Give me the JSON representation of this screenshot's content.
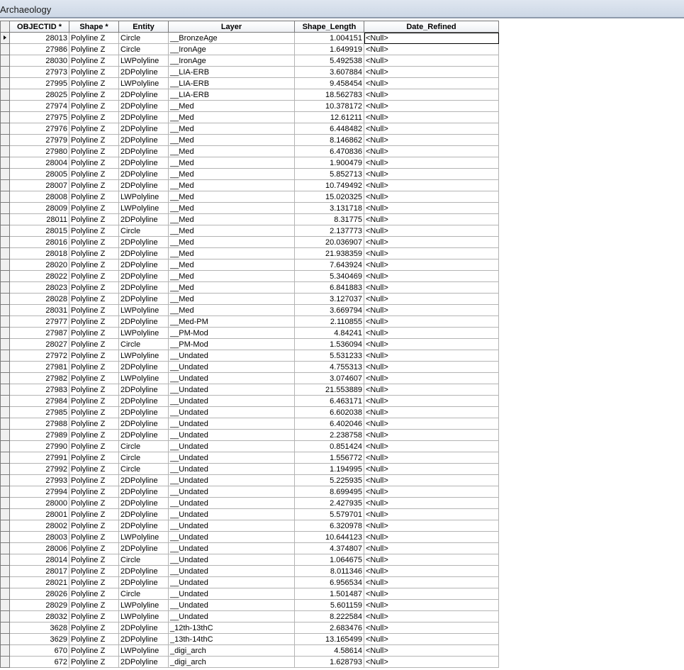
{
  "window": {
    "title": "Archaeology"
  },
  "table": {
    "columns": [
      "OBJECTID *",
      "Shape *",
      "Entity",
      "Layer",
      "Shape_Length",
      "Date_Refined"
    ],
    "rows": [
      [
        "28013",
        "Polyline Z",
        "Circle",
        "__BronzeAge",
        "1.004151",
        "<Null>"
      ],
      [
        "27986",
        "Polyline Z",
        "Circle",
        "__IronAge",
        "1.649919",
        "<Null>"
      ],
      [
        "28030",
        "Polyline Z",
        "LWPolyline",
        "__IronAge",
        "5.492538",
        "<Null>"
      ],
      [
        "27973",
        "Polyline Z",
        "2DPolyline",
        "__LIA-ERB",
        "3.607884",
        "<Null>"
      ],
      [
        "27995",
        "Polyline Z",
        "LWPolyline",
        "__LIA-ERB",
        "9.458454",
        "<Null>"
      ],
      [
        "28025",
        "Polyline Z",
        "2DPolyline",
        "__LIA-ERB",
        "18.562783",
        "<Null>"
      ],
      [
        "27974",
        "Polyline Z",
        "2DPolyline",
        "__Med",
        "10.378172",
        "<Null>"
      ],
      [
        "27975",
        "Polyline Z",
        "2DPolyline",
        "__Med",
        "12.61211",
        "<Null>"
      ],
      [
        "27976",
        "Polyline Z",
        "2DPolyline",
        "__Med",
        "6.448482",
        "<Null>"
      ],
      [
        "27979",
        "Polyline Z",
        "2DPolyline",
        "__Med",
        "8.146862",
        "<Null>"
      ],
      [
        "27980",
        "Polyline Z",
        "2DPolyline",
        "__Med",
        "6.470836",
        "<Null>"
      ],
      [
        "28004",
        "Polyline Z",
        "2DPolyline",
        "__Med",
        "1.900479",
        "<Null>"
      ],
      [
        "28005",
        "Polyline Z",
        "2DPolyline",
        "__Med",
        "5.852713",
        "<Null>"
      ],
      [
        "28007",
        "Polyline Z",
        "2DPolyline",
        "__Med",
        "10.749492",
        "<Null>"
      ],
      [
        "28008",
        "Polyline Z",
        "LWPolyline",
        "__Med",
        "15.020325",
        "<Null>"
      ],
      [
        "28009",
        "Polyline Z",
        "LWPolyline",
        "__Med",
        "3.131718",
        "<Null>"
      ],
      [
        "28011",
        "Polyline Z",
        "2DPolyline",
        "__Med",
        "8.31775",
        "<Null>"
      ],
      [
        "28015",
        "Polyline Z",
        "Circle",
        "__Med",
        "2.137773",
        "<Null>"
      ],
      [
        "28016",
        "Polyline Z",
        "2DPolyline",
        "__Med",
        "20.036907",
        "<Null>"
      ],
      [
        "28018",
        "Polyline Z",
        "2DPolyline",
        "__Med",
        "21.938359",
        "<Null>"
      ],
      [
        "28020",
        "Polyline Z",
        "2DPolyline",
        "__Med",
        "7.643924",
        "<Null>"
      ],
      [
        "28022",
        "Polyline Z",
        "2DPolyline",
        "__Med",
        "5.340469",
        "<Null>"
      ],
      [
        "28023",
        "Polyline Z",
        "2DPolyline",
        "__Med",
        "6.841883",
        "<Null>"
      ],
      [
        "28028",
        "Polyline Z",
        "2DPolyline",
        "__Med",
        "3.127037",
        "<Null>"
      ],
      [
        "28031",
        "Polyline Z",
        "LWPolyline",
        "__Med",
        "3.669794",
        "<Null>"
      ],
      [
        "27977",
        "Polyline Z",
        "2DPolyline",
        "__Med-PM",
        "2.110855",
        "<Null>"
      ],
      [
        "27987",
        "Polyline Z",
        "LWPolyline",
        "__PM-Mod",
        "4.84241",
        "<Null>"
      ],
      [
        "28027",
        "Polyline Z",
        "Circle",
        "__PM-Mod",
        "1.536094",
        "<Null>"
      ],
      [
        "27972",
        "Polyline Z",
        "LWPolyline",
        "__Undated",
        "5.531233",
        "<Null>"
      ],
      [
        "27981",
        "Polyline Z",
        "2DPolyline",
        "__Undated",
        "4.755313",
        "<Null>"
      ],
      [
        "27982",
        "Polyline Z",
        "LWPolyline",
        "__Undated",
        "3.074607",
        "<Null>"
      ],
      [
        "27983",
        "Polyline Z",
        "2DPolyline",
        "__Undated",
        "21.553889",
        "<Null>"
      ],
      [
        "27984",
        "Polyline Z",
        "2DPolyline",
        "__Undated",
        "6.463171",
        "<Null>"
      ],
      [
        "27985",
        "Polyline Z",
        "2DPolyline",
        "__Undated",
        "6.602038",
        "<Null>"
      ],
      [
        "27988",
        "Polyline Z",
        "2DPolyline",
        "__Undated",
        "6.402046",
        "<Null>"
      ],
      [
        "27989",
        "Polyline Z",
        "2DPolyline",
        "__Undated",
        "2.238758",
        "<Null>"
      ],
      [
        "27990",
        "Polyline Z",
        "Circle",
        "__Undated",
        "0.851424",
        "<Null>"
      ],
      [
        "27991",
        "Polyline Z",
        "Circle",
        "__Undated",
        "1.556772",
        "<Null>"
      ],
      [
        "27992",
        "Polyline Z",
        "Circle",
        "__Undated",
        "1.194995",
        "<Null>"
      ],
      [
        "27993",
        "Polyline Z",
        "2DPolyline",
        "__Undated",
        "5.225935",
        "<Null>"
      ],
      [
        "27994",
        "Polyline Z",
        "2DPolyline",
        "__Undated",
        "8.699495",
        "<Null>"
      ],
      [
        "28000",
        "Polyline Z",
        "2DPolyline",
        "__Undated",
        "2.427935",
        "<Null>"
      ],
      [
        "28001",
        "Polyline Z",
        "2DPolyline",
        "__Undated",
        "5.579701",
        "<Null>"
      ],
      [
        "28002",
        "Polyline Z",
        "2DPolyline",
        "__Undated",
        "6.320978",
        "<Null>"
      ],
      [
        "28003",
        "Polyline Z",
        "LWPolyline",
        "__Undated",
        "10.644123",
        "<Null>"
      ],
      [
        "28006",
        "Polyline Z",
        "2DPolyline",
        "__Undated",
        "4.374807",
        "<Null>"
      ],
      [
        "28014",
        "Polyline Z",
        "Circle",
        "__Undated",
        "1.064675",
        "<Null>"
      ],
      [
        "28017",
        "Polyline Z",
        "2DPolyline",
        "__Undated",
        "8.011346",
        "<Null>"
      ],
      [
        "28021",
        "Polyline Z",
        "2DPolyline",
        "__Undated",
        "6.956534",
        "<Null>"
      ],
      [
        "28026",
        "Polyline Z",
        "Circle",
        "__Undated",
        "1.501487",
        "<Null>"
      ],
      [
        "28029",
        "Polyline Z",
        "LWPolyline",
        "__Undated",
        "5.601159",
        "<Null>"
      ],
      [
        "28032",
        "Polyline Z",
        "LWPolyline",
        "__Undated",
        "8.222584",
        "<Null>"
      ],
      [
        "3628",
        "Polyline Z",
        "2DPolyline",
        "_12th-13thC",
        "2.683476",
        "<Null>"
      ],
      [
        "3629",
        "Polyline Z",
        "2DPolyline",
        "_13th-14thC",
        "13.165499",
        "<Null>"
      ],
      [
        "670",
        "Polyline Z",
        "LWPolyline",
        "_digi_arch",
        "4.58614",
        "<Null>"
      ],
      [
        "672",
        "Polyline Z",
        "2DPolyline",
        "_digi_arch",
        "1.628793",
        "<Null>"
      ]
    ]
  }
}
